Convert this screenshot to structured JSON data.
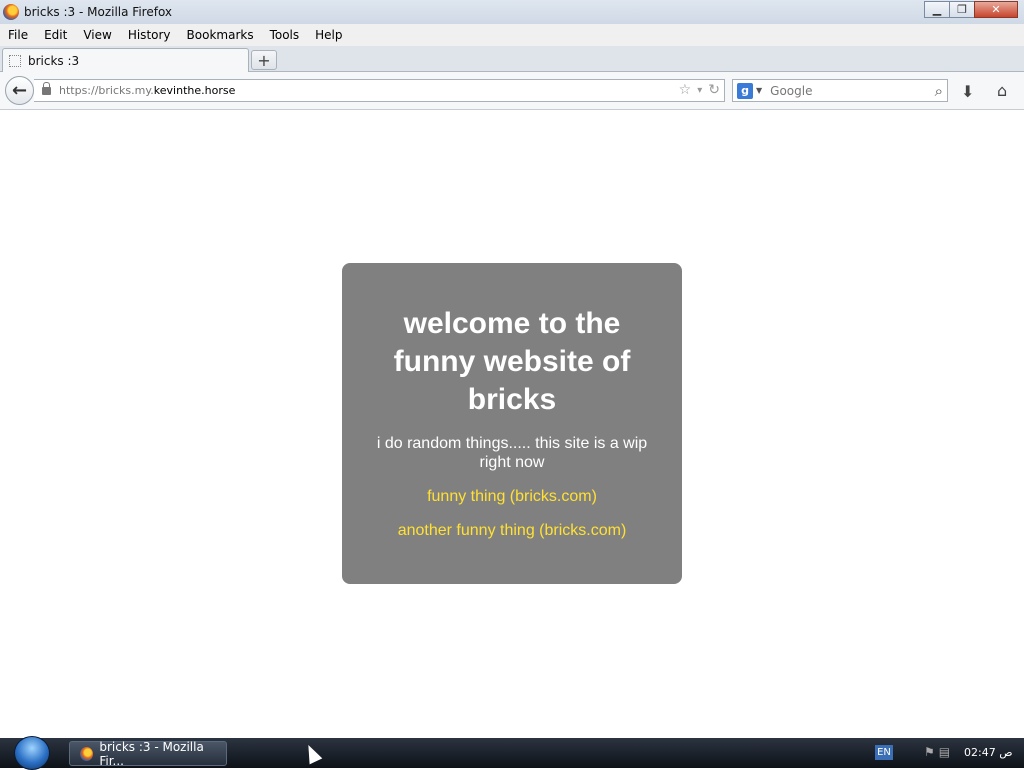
{
  "window": {
    "title": "bricks :3 - Mozilla Firefox",
    "controls": {
      "minimize": "▁",
      "maximize": "❐",
      "close": "✕"
    }
  },
  "menu": {
    "items": [
      "File",
      "Edit",
      "View",
      "History",
      "Bookmarks",
      "Tools",
      "Help"
    ]
  },
  "tabs": [
    {
      "label": "bricks :3",
      "active": true
    }
  ],
  "new_tab": "+",
  "nav": {
    "back_icon": "←",
    "url_prefix": "https://bricks.my.",
    "url_host": "kevinthe.horse",
    "bookmark_star": "☆",
    "dropdown": "▾",
    "reload": "↻",
    "search_engine_icon": "g",
    "search_placeholder": "Google",
    "search_go": "⌕",
    "download": "⬇",
    "home": "⌂"
  },
  "page": {
    "heading": "welcome to the funny website of bricks",
    "description": "i do random things..... this site is a wip right now",
    "links": [
      {
        "label": "funny thing (bricks.com)"
      },
      {
        "label": "another funny thing (bricks.com)"
      }
    ],
    "colors": {
      "card_bg": "#808080",
      "link": "#ffe033",
      "text": "#ffffff"
    }
  },
  "taskbar": {
    "task_label": "bricks :3 - Mozilla Fir...",
    "language": "EN",
    "clock": "02:47 ص"
  }
}
